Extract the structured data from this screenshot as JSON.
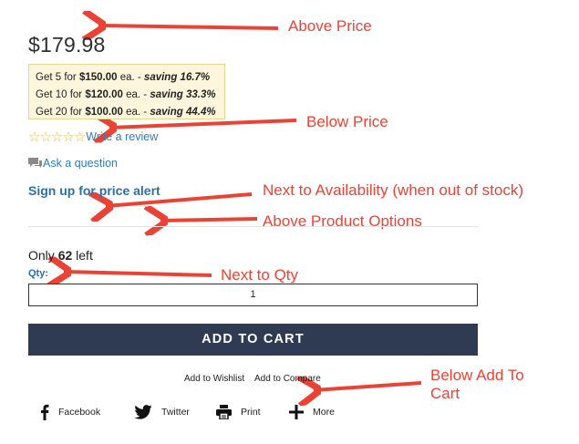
{
  "product": {
    "price": "$179.98",
    "tiers": [
      {
        "prefix": "Get 5 for ",
        "price": "$150.00",
        "mid": " ea. - ",
        "saving": "saving  16.7%"
      },
      {
        "prefix": "Get 10 for ",
        "price": "$120.00",
        "mid": " ea. - ",
        "saving": "saving  33.3%"
      },
      {
        "prefix": "Get 20 for ",
        "price": "$100.00",
        "mid": " ea. - ",
        "saving": "saving  44.4%"
      }
    ],
    "review_link": "Write a review",
    "ask_link": "Ask a question",
    "price_alert": "Sign up for price alert",
    "stock_prefix": "Only ",
    "stock_count": "62",
    "stock_suffix": " left",
    "qty_label": "Qty:",
    "qty_value": "1",
    "add_to_cart": "ADD TO CART",
    "wishlist": "Add to Wishlist",
    "compare": "Add to Compare"
  },
  "share": {
    "facebook": "Facebook",
    "twitter": "Twitter",
    "print": "Print",
    "more": "More"
  },
  "annotations": {
    "above_price": "Above Price",
    "below_price": "Below Price",
    "next_to_availability": "Next to Availability (when out of stock)",
    "above_options": "Above Product Options",
    "next_to_qty": "Next to Qty",
    "below_cart_line1": "Below Add To",
    "below_cart_line2": "Cart"
  },
  "colors": {
    "link": "#2d7fba",
    "button": "#2e3b52",
    "annotation": "#ea4335",
    "tier_bg": "#fdf6dc",
    "star": "#e7b934"
  }
}
